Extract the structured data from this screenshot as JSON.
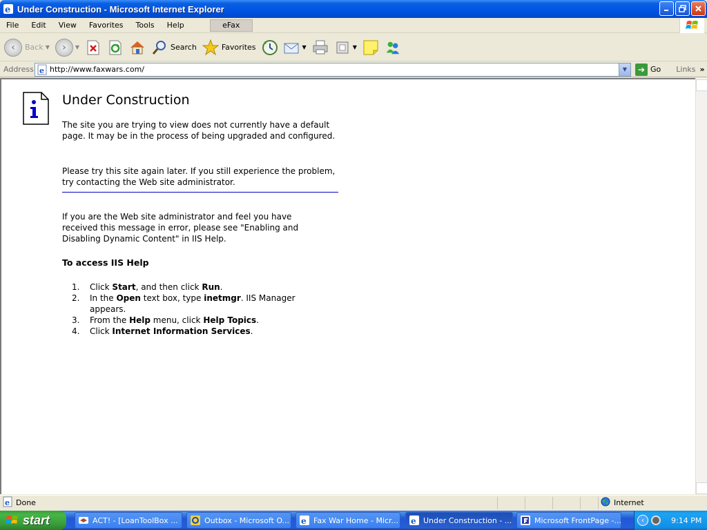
{
  "window": {
    "title": "Under Construction - Microsoft Internet Explorer",
    "accent_color": "#0054e3"
  },
  "menubar": {
    "items": [
      "File",
      "Edit",
      "View",
      "Favorites",
      "Tools",
      "Help"
    ],
    "efax": "eFax"
  },
  "toolbar": {
    "back": "Back",
    "search": "Search",
    "favorites": "Favorites"
  },
  "address": {
    "label": "Address",
    "url": "http://www.faxwars.com/",
    "go": "Go",
    "links": "Links"
  },
  "page": {
    "title": "Under Construction",
    "p1": "The site you are trying to view does not currently have a default page. It may be in the process of being upgraded and configured.",
    "p2": "Please try this site again later. If you still experience the problem, try contacting the Web site administrator.",
    "p3": "If you are the Web site administrator and feel you have received this message in error, please see \"Enabling and Disabling Dynamic Content\" in IIS Help.",
    "help_heading": "To access IIS Help",
    "divider_color": "#0000cc",
    "steps": [
      {
        "num": "1.",
        "parts": [
          {
            "t": "Click ",
            "b": false
          },
          {
            "t": "Start",
            "b": true
          },
          {
            "t": ", and then click ",
            "b": false
          },
          {
            "t": "Run",
            "b": true
          },
          {
            "t": ".",
            "b": false
          }
        ]
      },
      {
        "num": "2.",
        "parts": [
          {
            "t": "In the ",
            "b": false
          },
          {
            "t": "Open",
            "b": true
          },
          {
            "t": " text box, type ",
            "b": false
          },
          {
            "t": "inetmgr",
            "b": true
          },
          {
            "t": ". IIS Manager appears.",
            "b": false
          }
        ]
      },
      {
        "num": "3.",
        "parts": [
          {
            "t": "From the ",
            "b": false
          },
          {
            "t": "Help",
            "b": true
          },
          {
            "t": " menu, click ",
            "b": false
          },
          {
            "t": "Help Topics",
            "b": true
          },
          {
            "t": ".",
            "b": false
          }
        ]
      },
      {
        "num": "4.",
        "parts": [
          {
            "t": "Click ",
            "b": false
          },
          {
            "t": "Internet Information Services",
            "b": true
          },
          {
            "t": ".",
            "b": false
          }
        ]
      }
    ]
  },
  "statusbar": {
    "status": "Done",
    "zone": "Internet"
  },
  "taskbar": {
    "start": "start",
    "tasks": [
      {
        "label": "ACT! - [LoanToolBox ...",
        "active": false
      },
      {
        "label": "Outbox - Microsoft O...",
        "active": false
      },
      {
        "label": "Fax War Home - Micr...",
        "active": false
      },
      {
        "label": "Under Construction - ...",
        "active": true
      },
      {
        "label": "Microsoft FrontPage -...",
        "active": false
      }
    ],
    "clock": "9:14 PM"
  }
}
